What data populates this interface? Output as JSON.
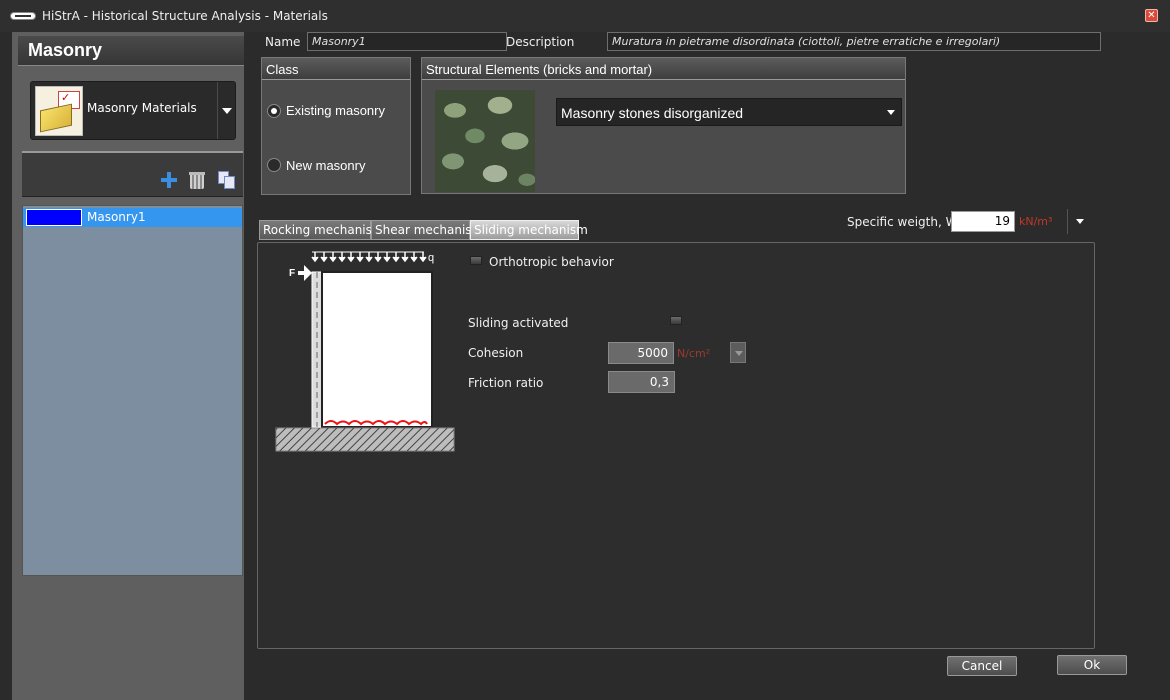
{
  "window": {
    "title": "HiStrA - Historical Structure Analysis - Materials"
  },
  "sidebar": {
    "header": "Masonry",
    "material_type": "Masonry Materials",
    "list": [
      {
        "name": "Masonry1",
        "color": "#0000ff"
      }
    ]
  },
  "form": {
    "name_label": "Name",
    "name_value": "Masonry1",
    "description_label": "Description",
    "description_value": "Muratura in pietrame disordinata (ciottoli, pietre erratiche e irregolari)",
    "class": {
      "title": "Class",
      "options": [
        "Existing masonry",
        "New masonry"
      ],
      "selected": "Existing masonry"
    },
    "structural": {
      "title": "Structural Elements (bricks and mortar)",
      "selected": "Masonry stones disorganized"
    },
    "specific_weight": {
      "label": "Specific weigth, W",
      "value": "19",
      "unit": "kN/m³"
    }
  },
  "tabs": [
    "Rocking mechanism",
    "Shear mechanism",
    "Sliding mechanism"
  ],
  "active_tab": "Sliding mechanism",
  "sliding": {
    "orthotropic_label": "Orthotropic behavior",
    "sliding_activated_label": "Sliding activated",
    "cohesion": {
      "label": "Cohesion",
      "value": "5000",
      "unit": "N/cm²"
    },
    "friction": {
      "label": "Friction ratio",
      "value": "0,3"
    },
    "diagram": {
      "force_label": "F",
      "load_label": "q"
    }
  },
  "buttons": {
    "cancel": "Cancel",
    "ok": "Ok"
  }
}
